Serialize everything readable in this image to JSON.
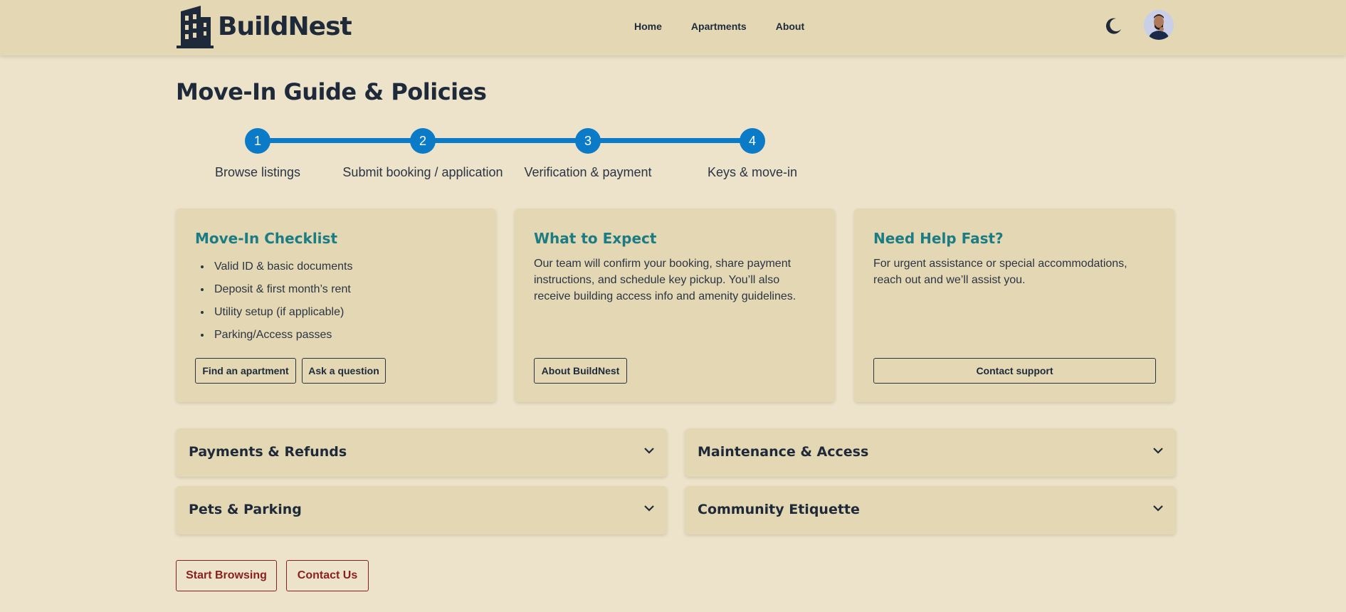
{
  "brand": {
    "name": "BuildNest"
  },
  "nav": {
    "home": "Home",
    "apartments": "Apartments",
    "about": "About"
  },
  "page": {
    "title": "Move-In Guide & Policies"
  },
  "steps": [
    {
      "number": "1",
      "label": "Browse listings"
    },
    {
      "number": "2",
      "label": "Submit booking / application"
    },
    {
      "number": "3",
      "label": "Verification & payment"
    },
    {
      "number": "4",
      "label": "Keys & move-in"
    }
  ],
  "cards": {
    "checklist": {
      "title": "Move-In Checklist",
      "items": [
        "Valid ID & basic documents",
        "Deposit & first month’s rent",
        "Utility setup (if applicable)",
        "Parking/Access passes"
      ],
      "buttons": [
        "Find an apartment",
        "Ask a question"
      ]
    },
    "expect": {
      "title": "What to Expect",
      "text": "Our team will confirm your booking, share payment instructions, and schedule key pickup. You’ll also receive building access info and amenity guidelines.",
      "button": "About BuildNest"
    },
    "help": {
      "title": "Need Help Fast?",
      "text": "For urgent assistance or special accommodations, reach out and we’ll assist you.",
      "button": "Contact support"
    }
  },
  "accordions": [
    "Payments & Refunds",
    "Maintenance & Access",
    "Pets & Parking",
    "Community Etiquette"
  ],
  "footer_buttons": {
    "start": "Start Browsing",
    "contact": "Contact Us"
  },
  "colors": {
    "accent": "#0b7bc8",
    "heading_teal": "#1c7c84",
    "cta_red": "#8a1f1f",
    "background": "#ede3ca",
    "panel": "#e4d8b4"
  },
  "icons": {
    "logo": "building-icon",
    "theme": "moon-icon",
    "accordion": "chevron-down-icon"
  }
}
